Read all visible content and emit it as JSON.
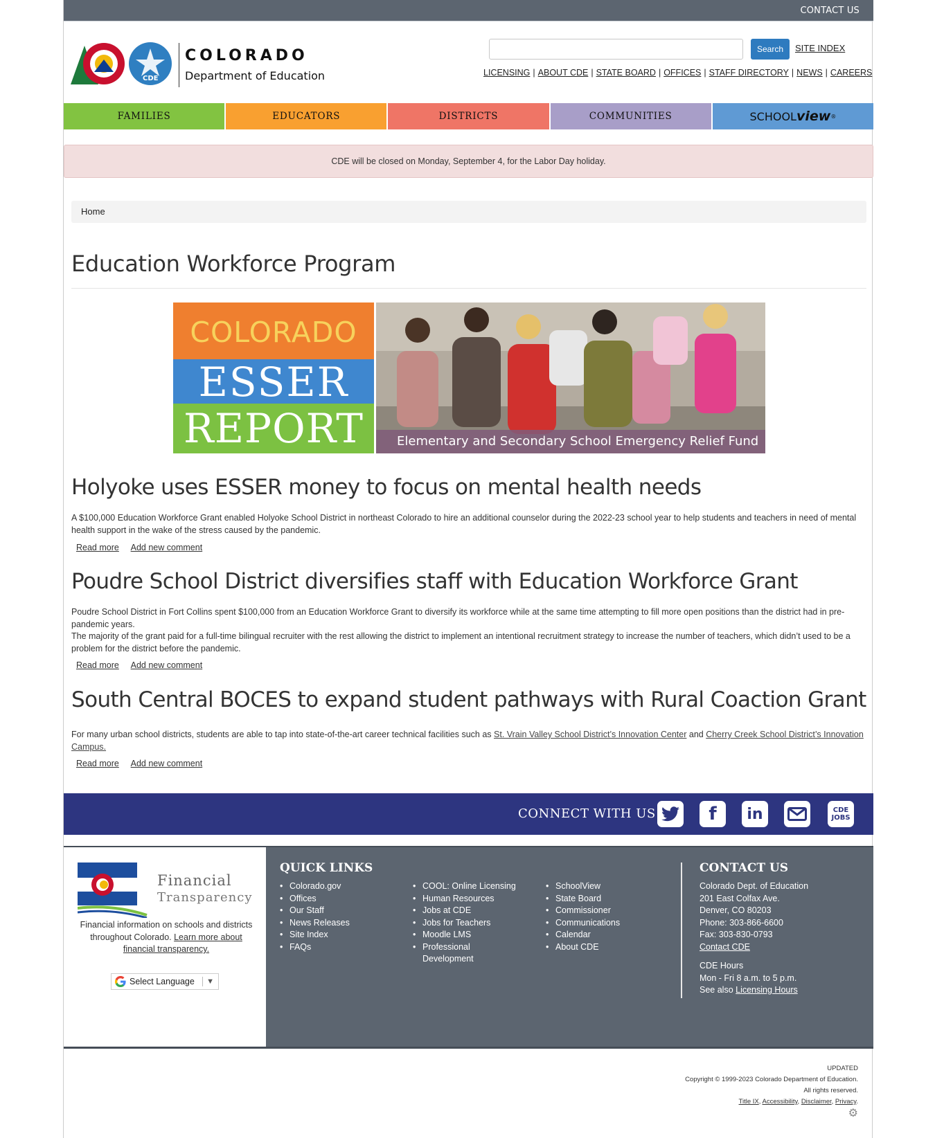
{
  "topbar": {
    "contact_label": "CONTACT US"
  },
  "header": {
    "logo_line1": "COLORADO",
    "logo_line2": "Department of Education",
    "search_placeholder": "",
    "search_button": "Search",
    "site_index": "SITE INDEX",
    "utility_links": [
      "LICENSING",
      "ABOUT CDE",
      "STATE BOARD",
      "OFFICES",
      "STAFF DIRECTORY",
      "NEWS",
      "CAREERS"
    ]
  },
  "nav": {
    "items": [
      {
        "label": "FAMILIES",
        "color": "#82c341"
      },
      {
        "label": "EDUCATORS",
        "color": "#f9a030"
      },
      {
        "label": "DISTRICTS",
        "color": "#ef7566"
      },
      {
        "label": "COMMUNITIES",
        "color": "#a89ec8"
      }
    ],
    "schoolview_a": "SCHOOL",
    "schoolview_b": "view",
    "schoolview_color": "#5f9ad4"
  },
  "alert": {
    "text": "CDE will be closed on Monday, September 4, for the Labor Day holiday."
  },
  "breadcrumb": {
    "home": "Home"
  },
  "page_title": "Education Workforce Program",
  "banner": {
    "line1": "COLORADO",
    "line2": "ESSER",
    "line3": "REPORT",
    "caption": "Elementary and Secondary School Emergency Relief Fund"
  },
  "articles": [
    {
      "title": "Holyoke uses ESSER money to focus on mental health needs",
      "body": "A $100,000 Education Workforce Grant enabled Holyoke School District in northeast Colorado to hire an additional counselor during the 2022-23 school year to help students and teachers in need of mental health support in the wake of the stress caused by the pandemic.",
      "read_more": "Read more",
      "comment": "Add new comment"
    },
    {
      "title": "Poudre School District diversifies staff with Education Workforce Grant",
      "body1": "Poudre School District in Fort Collins spent $100,000 from an Education Workforce Grant to diversify its workforce while at the same time attempting to fill more open positions than the district had in pre-pandemic years.",
      "body2": "The majority of the grant paid for a full-time bilingual recruiter with the rest allowing the district to implement an intentional recruitment strategy to increase the number of teachers, which didn’t used to be a problem for the district before the pandemic.",
      "read_more": "Read more",
      "comment": "Add new comment"
    },
    {
      "title": "South Central BOCES to expand student pathways with Rural Coaction Grant",
      "body_start": "For many urban school districts, students are able to tap into state-of-the-art career technical facilities such as ",
      "link1": "St. Vrain Valley School District’s Innovation Center",
      "body_mid": " and ",
      "link2": "Cherry Creek School District’s Innovation Campus.",
      "read_more": "Read more",
      "comment": "Add new comment"
    }
  ],
  "connect": {
    "label": "CONNECT WITH US",
    "jobs_line1": "CDE",
    "jobs_line2": "JOBS"
  },
  "footer": {
    "ft_logo_line1": "Financial",
    "ft_logo_line2": "Transparency",
    "ft_desc": "Financial information on schools and districts throughout Colorado. ",
    "ft_link": "Learn more about financial transparency.",
    "language": "Select Language",
    "quick_links_title": "QUICK LINKS",
    "col1": [
      "Colorado.gov",
      "Offices",
      "Our Staff",
      "News Releases",
      "Site Index",
      "FAQs"
    ],
    "col2": [
      "COOL: Online Licensing",
      "Human Resources",
      "Jobs at CDE",
      "Jobs for Teachers",
      "Moodle LMS",
      "Professional Development"
    ],
    "col3": [
      "SchoolView",
      "State Board",
      "Commissioner",
      "Communications",
      "Calendar",
      "About CDE"
    ],
    "contact_title": "CONTACT US",
    "contact_lines": [
      "Colorado Dept. of Education",
      "201 East Colfax Ave.",
      "Denver, CO 80203",
      "Phone: 303-866-6600",
      "Fax: 303-830-0793"
    ],
    "contact_link": "Contact CDE",
    "hours_title": "CDE Hours",
    "hours_line": "Mon - Fri 8 a.m. to 5 p.m.",
    "see_also": "See also ",
    "licensing_hours": "Licensing Hours"
  },
  "bottom": {
    "updated": "UPDATED",
    "copyright": "Copyright © 1999-2023 Colorado Department of Education.",
    "rights": "All rights reserved.",
    "links": [
      "Title IX",
      "Accessibility",
      "Disclaimer",
      "Privacy"
    ]
  }
}
